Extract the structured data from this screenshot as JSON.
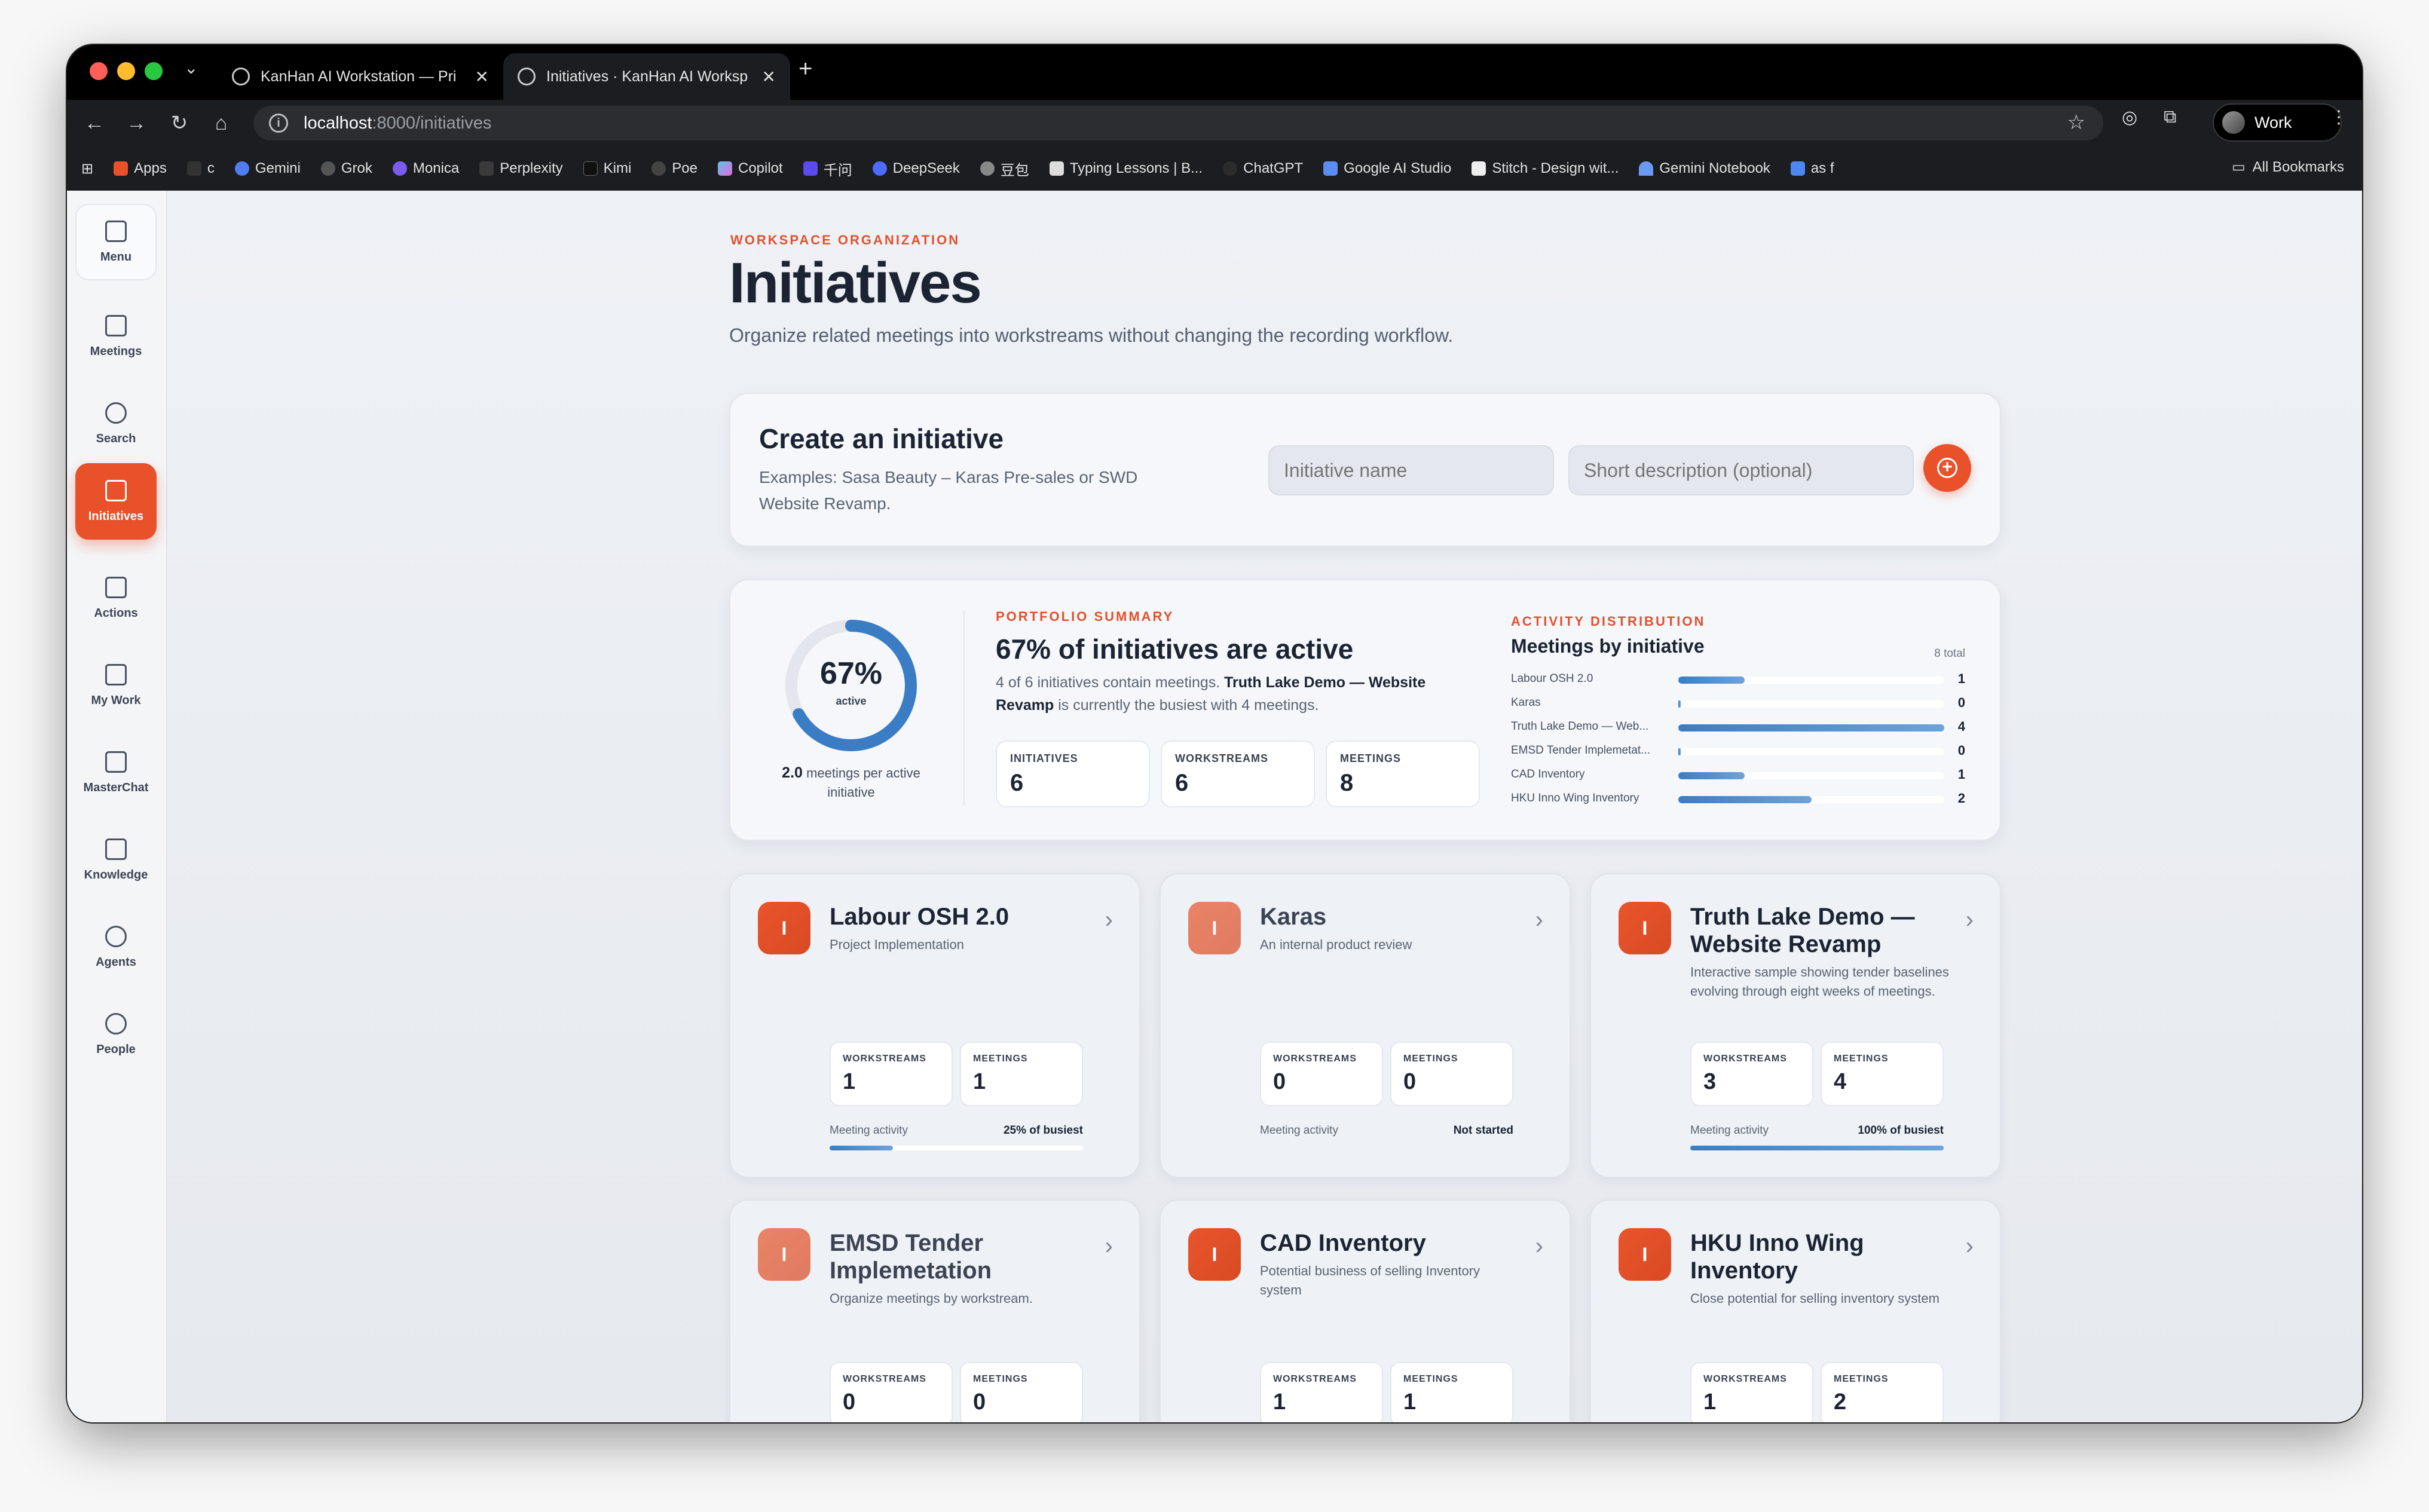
{
  "browser": {
    "tabs": [
      {
        "title": "KanHan AI Workstation — Pri"
      },
      {
        "title": "Initiatives · KanHan AI Worksp"
      }
    ],
    "url_host": "localhost",
    "url_path": ":8000/initiatives",
    "profile": "Work",
    "bookmarks": [
      "Apps",
      "c",
      "Gemini",
      "Grok",
      "Monica",
      "Perplexity",
      "Kimi",
      "Poe",
      "Copilot",
      "千问",
      "DeepSeek",
      "豆包",
      "Typing Lessons | B...",
      "ChatGPT",
      "Google AI Studio",
      "Stitch - Design wit...",
      "Gemini Notebook",
      "as f"
    ],
    "all_bookmarks": "All Bookmarks"
  },
  "sidebar": {
    "items": [
      {
        "label": "Menu"
      },
      {
        "label": "Meetings"
      },
      {
        "label": "Search"
      },
      {
        "label": "Initiatives"
      },
      {
        "label": "Actions"
      },
      {
        "label": "My Work"
      },
      {
        "label": "MasterChat"
      },
      {
        "label": "Knowledge"
      },
      {
        "label": "Agents"
      },
      {
        "label": "People"
      }
    ]
  },
  "header": {
    "kicker": "WORKSPACE ORGANIZATION",
    "title": "Initiatives",
    "subtitle": "Organize related meetings into workstreams without changing the recording workflow."
  },
  "create": {
    "title": "Create an initiative",
    "desc": "Examples: Sasa Beauty – Karas Pre-sales or SWD Website Revamp.",
    "name_placeholder": "Initiative name",
    "desc_placeholder": "Short description (optional)"
  },
  "summary": {
    "donut_value": "67%",
    "donut_label": "active",
    "donut_fraction": 0.67,
    "per_value": "2.0",
    "per_label": "meetings per active initiative",
    "kicker": "PORTFOLIO SUMMARY",
    "headline": "67% of initiatives are active",
    "text_a": "4 of 6 initiatives contain meetings. ",
    "text_b": "Truth Lake Demo — Website Revamp",
    "text_c": " is currently the busiest with 4 meetings.",
    "stats": [
      {
        "label": "INITIATIVES",
        "value": "6"
      },
      {
        "label": "WORKSTREAMS",
        "value": "6"
      },
      {
        "label": "MEETINGS",
        "value": "8"
      }
    ]
  },
  "distribution": {
    "kicker": "ACTIVITY DISTRIBUTION",
    "title": "Meetings by initiative",
    "total": "8 total",
    "max": 4,
    "rows": [
      {
        "name": "Labour OSH 2.0",
        "count": 1
      },
      {
        "name": "Karas",
        "count": 0
      },
      {
        "name": "Truth Lake Demo — Web...",
        "count": 4
      },
      {
        "name": "EMSD Tender Implemetat...",
        "count": 0
      },
      {
        "name": "CAD Inventory",
        "count": 1
      },
      {
        "name": "HKU Inno Wing Inventory",
        "count": 2
      }
    ]
  },
  "initiatives": [
    {
      "badge": "I",
      "name": "Labour OSH 2.0",
      "desc": "Project Implementation",
      "ws_label": "WORKSTREAMS",
      "ws": "1",
      "mt_label": "MEETINGS",
      "mt": "1",
      "act_label": "Meeting activity",
      "act_value": "25% of busiest",
      "activity": 0.25
    },
    {
      "badge": "I",
      "name": "Karas",
      "desc": "An internal product review",
      "ws_label": "WORKSTREAMS",
      "ws": "0",
      "mt_label": "MEETINGS",
      "mt": "0",
      "act_label": "Meeting activity",
      "act_value": "Not started",
      "activity": 0
    },
    {
      "badge": "I",
      "name": "Truth Lake Demo — Website Revamp",
      "desc": "Interactive sample showing tender baselines evolving through eight weeks of meetings.",
      "ws_label": "WORKSTREAMS",
      "ws": "3",
      "mt_label": "MEETINGS",
      "mt": "4",
      "act_label": "Meeting activity",
      "act_value": "100% of busiest",
      "activity": 1
    },
    {
      "badge": "I",
      "name": "EMSD Tender Implemetation",
      "desc": "Organize meetings by workstream.",
      "ws_label": "WORKSTREAMS",
      "ws": "0",
      "mt_label": "MEETINGS",
      "mt": "0"
    },
    {
      "badge": "I",
      "name": "CAD Inventory",
      "desc": "Potential business of selling Inventory system",
      "ws_label": "WORKSTREAMS",
      "ws": "1",
      "mt_label": "MEETINGS",
      "mt": "1"
    },
    {
      "badge": "I",
      "name": "HKU Inno Wing Inventory",
      "desc": "Close potential for selling inventory system",
      "ws_label": "WORKSTREAMS",
      "ws": "1",
      "mt_label": "MEETINGS",
      "mt": "2"
    }
  ],
  "colors": {
    "accent": "#e8512a",
    "bar": "#3b7dc4"
  }
}
